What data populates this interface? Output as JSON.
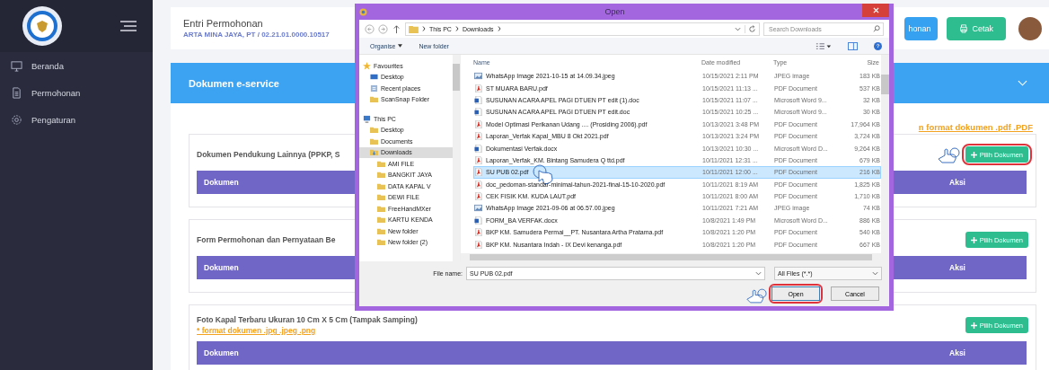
{
  "sidebar": {
    "items": [
      {
        "label": "Beranda",
        "selected": false
      },
      {
        "label": "Permohonan",
        "selected": false
      },
      {
        "label": "Pengaturan",
        "selected": false
      }
    ]
  },
  "header": {
    "title": "Entri Permohonan",
    "subtitle": "ARTA MINA JAYA, PT / 02.21.01.0000.10517",
    "buttons": [
      {
        "label": "honan",
        "kind": "primary"
      },
      {
        "label": "Cetak",
        "kind": "print"
      }
    ]
  },
  "panel": {
    "title": "Dokumen e-service",
    "note": "n format dokumen .pdf .PDF",
    "sections": [
      {
        "title": "Dokumen Pendukung Lainnya (PPKP, S",
        "button": "Pilih Dokumen",
        "highlighted": true,
        "columns": [
          "Dokumen",
          "Aksi"
        ]
      },
      {
        "title": "Form Permohonan dan Pernyataan Be",
        "button": "Pilih Dokumen",
        "highlighted": false,
        "columns": [
          "Dokumen",
          "Aksi"
        ]
      },
      {
        "title": "Foto Kapal Terbaru Ukuran 10 Cm X 5 Cm (Tampak Samping)",
        "note": "* format dokumen .jpg .jpeg .png",
        "button": "Pilih Dokumen",
        "highlighted": false,
        "columns": [
          "Dokumen",
          "Aksi"
        ]
      }
    ]
  },
  "dialog": {
    "title": "Open",
    "path": [
      "This PC",
      "Downloads"
    ],
    "search_placeholder": "Search Downloads",
    "toolbar": [
      "Organise",
      "New folder"
    ],
    "nav": [
      {
        "label": "Favourites",
        "kind": "star",
        "selected": false,
        "children": [
          {
            "label": "Desktop",
            "kind": "desktop",
            "selected": false
          },
          {
            "label": "Recent places",
            "kind": "recent",
            "selected": false
          },
          {
            "label": "ScanSnap Folder",
            "kind": "folder",
            "selected": false
          }
        ]
      },
      {
        "label": "This PC",
        "kind": "computer",
        "selected": false,
        "children": [
          {
            "label": "Desktop",
            "kind": "folder",
            "selected": false
          },
          {
            "label": "Documents",
            "kind": "folder",
            "selected": false
          },
          {
            "label": "Downloads",
            "kind": "downloads",
            "selected": true,
            "children": [
              {
                "label": "AMI FILE",
                "kind": "folder",
                "selected": false
              },
              {
                "label": "BANGKIT JAYA",
                "kind": "folder",
                "selected": false
              },
              {
                "label": "DATA KAPAL V",
                "kind": "folder",
                "selected": false
              },
              {
                "label": "DEWI FILE",
                "kind": "folder",
                "selected": false
              },
              {
                "label": "FreeHandMXer",
                "kind": "folder",
                "selected": false
              },
              {
                "label": "KARTU KENDA",
                "kind": "folder",
                "selected": false
              },
              {
                "label": "New folder",
                "kind": "folder",
                "selected": false
              },
              {
                "label": "New folder (2)",
                "kind": "folder",
                "selected": false
              }
            ]
          }
        ]
      }
    ],
    "columns": [
      "Name",
      "Date modified",
      "Type",
      "Size"
    ],
    "files": [
      {
        "name": "WhatsApp Image 2021-10-15 at 14.09.34.jpeg",
        "kind": "image",
        "date": "10/15/2021 2:11 PM",
        "type": "JPEG image",
        "size": "183 KB",
        "selected": false
      },
      {
        "name": "ST MUARA BARU.pdf",
        "kind": "pdf",
        "date": "10/15/2021 11:13 ...",
        "type": "PDF Document",
        "size": "537 KB",
        "selected": false
      },
      {
        "name": "SUSUNAN ACARA APEL PAGI DTUEN PT edit (1).doc",
        "kind": "word",
        "date": "10/15/2021 11:07 ...",
        "type": "Microsoft Word 9...",
        "size": "32 KB",
        "selected": false
      },
      {
        "name": "SUSUNAN ACARA APEL PAGI DTUEN PT edit.doc",
        "kind": "word",
        "date": "10/15/2021 10:25 ...",
        "type": "Microsoft Word 9...",
        "size": "30 KB",
        "selected": false
      },
      {
        "name": "Model Optimasi Perikanan Udang .... (Prosiding 2006).pdf",
        "kind": "pdf",
        "date": "10/13/2021 3:48 PM",
        "type": "PDF Document",
        "size": "17,964 KB",
        "selected": false
      },
      {
        "name": "Laporan_Verfak Kapal_MBU 8 Okt 2021.pdf",
        "kind": "pdf",
        "date": "10/13/2021 3:24 PM",
        "type": "PDF Document",
        "size": "3,724 KB",
        "selected": false
      },
      {
        "name": "Dokumentasi Verfak.docx",
        "kind": "word",
        "date": "10/13/2021 10:30 ...",
        "type": "Microsoft Word D...",
        "size": "9,264 KB",
        "selected": false
      },
      {
        "name": "Laporan_Verfak_KM. Bintang Samudera Q  ttd.pdf",
        "kind": "pdf",
        "date": "10/11/2021 12:31 ...",
        "type": "PDF Document",
        "size": "679 KB",
        "selected": false
      },
      {
        "name": "SU PUB 02.pdf",
        "kind": "pdf",
        "date": "10/11/2021 12:00 ...",
        "type": "PDF Document",
        "size": "216 KB",
        "selected": true
      },
      {
        "name": "doc_pedoman-standar-minimal-tahun-2021-final-15-10-2020.pdf",
        "kind": "pdf",
        "date": "10/11/2021 8:19 AM",
        "type": "PDF Document",
        "size": "1,825 KB",
        "selected": false
      },
      {
        "name": "CEK FISIK KM. KUDA LAUT.pdf",
        "kind": "pdf",
        "date": "10/11/2021 8:00 AM",
        "type": "PDF Document",
        "size": "1,710 KB",
        "selected": false
      },
      {
        "name": "WhatsApp Image 2021-09-06 at 06.57.00.jpeg",
        "kind": "image",
        "date": "10/11/2021 7:21 AM",
        "type": "JPEG image",
        "size": "74 KB",
        "selected": false
      },
      {
        "name": "FORM_BA VERFAK.docx",
        "kind": "word",
        "date": "10/8/2021 1:49 PM",
        "type": "Microsoft Word D...",
        "size": "886 KB",
        "selected": false
      },
      {
        "name": "BKP KM. Samudera Permai__PT. Nusantara Artha Pratama.pdf",
        "kind": "pdf",
        "date": "10/8/2021 1:20 PM",
        "type": "PDF Document",
        "size": "540 KB",
        "selected": false
      },
      {
        "name": "BKP KM. Nusantara Indah - IX  Devi kenanga.pdf",
        "kind": "pdf",
        "date": "10/8/2021 1:20 PM",
        "type": "PDF Document",
        "size": "667 KB",
        "selected": false
      }
    ],
    "file_name_label": "File name:",
    "file_name": "SU PUB 02.pdf",
    "filter": "All Files (*.*)",
    "buttons": [
      {
        "label": "Open",
        "highlighted": true
      },
      {
        "label": "Cancel",
        "highlighted": false
      }
    ]
  }
}
